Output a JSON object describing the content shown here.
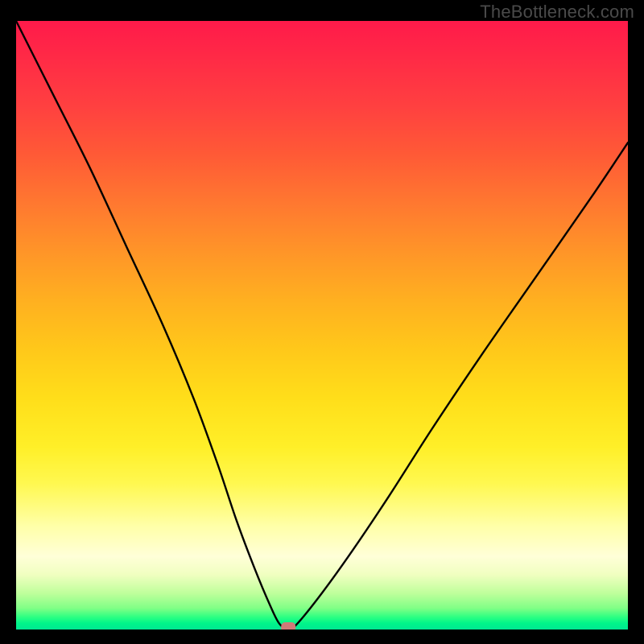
{
  "watermark": "TheBottleneck.com",
  "chart_data": {
    "type": "line",
    "title": "",
    "xlabel": "",
    "ylabel": "",
    "xlim": [
      0,
      100
    ],
    "ylim": [
      0,
      100
    ],
    "background_gradient_meaning": "red (top) = high bottleneck, green (bottom) = low bottleneck",
    "series": [
      {
        "name": "bottleneck-curve",
        "x": [
          0,
          6,
          12,
          18,
          24,
          29,
          33,
          36,
          39,
          41.5,
          43,
          44.5,
          46,
          50,
          55,
          61,
          68,
          76,
          85,
          94,
          100
        ],
        "values": [
          100,
          88,
          76,
          63,
          50,
          38,
          27,
          18,
          10,
          4,
          1,
          0,
          1,
          6,
          13,
          22,
          33,
          45,
          58,
          71,
          80
        ]
      }
    ],
    "marker": {
      "name": "optimal-point",
      "x": 44.5,
      "y": 0,
      "color": "#cf7a78",
      "shape": "rounded-rect"
    }
  }
}
